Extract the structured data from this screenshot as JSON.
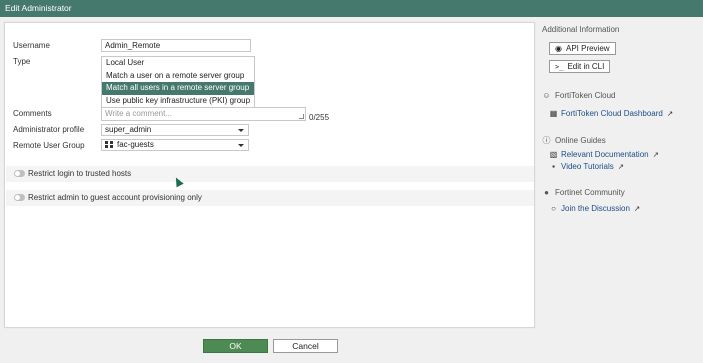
{
  "window": {
    "title": "Edit Administrator"
  },
  "form": {
    "username_label": "Username",
    "username_value": "Admin_Remote",
    "type_label": "Type",
    "type_options": [
      "Local User",
      "Match a user on a remote server group",
      "Match all users in a remote server group",
      "Use public key infrastructure (PKI) group"
    ],
    "type_selected": "Match all users in a remote server group",
    "comments_label": "Comments",
    "comments_placeholder": "Write a comment...",
    "comments_counter": "0/255",
    "admin_profile_label": "Administrator profile",
    "admin_profile_value": "super_admin",
    "remote_group_label": "Remote User Group",
    "remote_group_value": "fac-guests",
    "restrict_trusted_label": "Restrict login to trusted hosts",
    "restrict_trusted_enabled": false,
    "restrict_guest_label": "Restrict admin to guest account provisioning only",
    "restrict_guest_enabled": false
  },
  "sidebar": {
    "additional_info": "Additional Information",
    "api_preview": "API Preview",
    "edit_cli": "Edit in CLI",
    "fortitoken_head": "FortiToken Cloud",
    "fortitoken_link": "FortiToken Cloud Dashboard",
    "online_guides_head": "Online Guides",
    "relevant_docs": "Relevant Documentation",
    "video_tutorials": "Video Tutorials",
    "community_head": "Fortinet Community",
    "join_discussion": "Join the Discussion"
  },
  "footer": {
    "ok": "OK",
    "cancel": "Cancel"
  },
  "colors": {
    "accent": "#46796d",
    "ok_button": "#4e8b54",
    "link": "#1f4e86"
  }
}
